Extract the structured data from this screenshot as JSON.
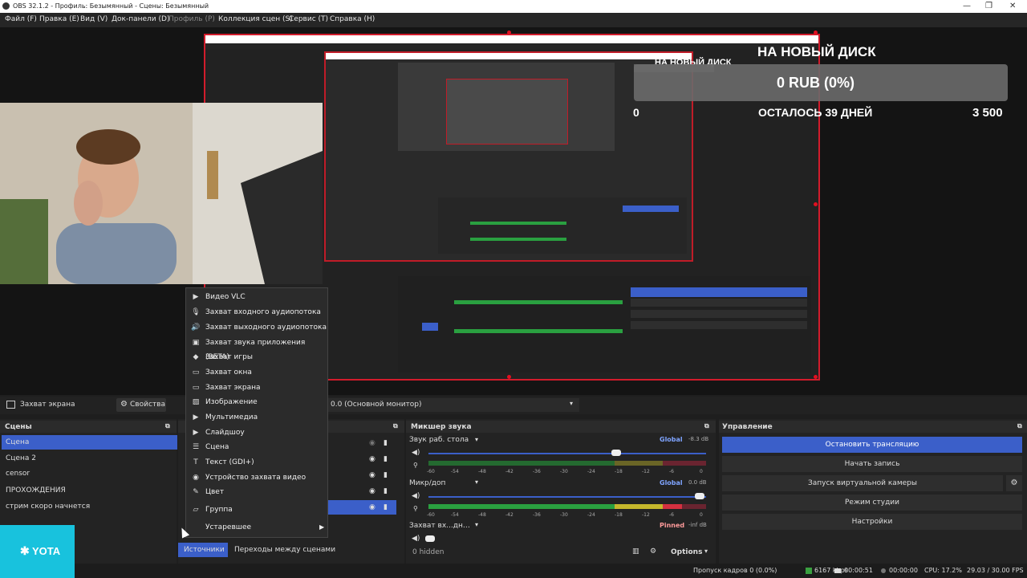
{
  "window": {
    "title": "OBS 32.1.2 - Профиль: Безымянный - Сцены: Безымянный",
    "minimize": "—",
    "maximize": "❐",
    "close": "✕"
  },
  "menu": [
    {
      "label": "Файл (F)"
    },
    {
      "label": "Правка (E)"
    },
    {
      "label": "Вид (V)"
    },
    {
      "label": "Док-панели (D)"
    },
    {
      "label": "Профиль (P)"
    },
    {
      "label": "Коллекция сцен (S)"
    },
    {
      "label": "Сервис (T)"
    },
    {
      "label": "Справка (H)"
    }
  ],
  "overlay": {
    "headline": "НА НОВЫЙ ДИСК",
    "progress_text": "0 RUB (0%)",
    "remaining": "ОСТАЛОСЬ 39 ДНЕЙ",
    "start_value": "0",
    "goal_value": "3 500",
    "nested_headline": "НА НОВЫЙ ДИСК"
  },
  "source_toolbar": {
    "source_name": "Захват экрана",
    "properties": "Свойства",
    "monitor": "0.0 (Основной монитор)"
  },
  "scenes": {
    "header": "Сцены",
    "items": [
      {
        "label": "Сцена",
        "selected": true
      },
      {
        "label": "Сцена 2"
      },
      {
        "label": "censor"
      },
      {
        "label": "ПРОХОЖДЕНИЯ"
      },
      {
        "label": "стрим скоро начнется"
      }
    ]
  },
  "context_menu": {
    "items": [
      {
        "label": "Видео VLC",
        "icon": "play-icon"
      },
      {
        "label": "Захват входного аудиопотока",
        "icon": "mic-icon"
      },
      {
        "label": "Захват выходного аудиопотока",
        "icon": "speaker-icon"
      },
      {
        "label": "Захват звука приложения (BETA)",
        "icon": "app-audio-icon"
      },
      {
        "label": "Захват игры",
        "icon": "gamepad-icon"
      },
      {
        "label": "Захват окна",
        "icon": "window-icon"
      },
      {
        "label": "Захват экрана",
        "icon": "monitor-icon"
      },
      {
        "label": "Изображение",
        "icon": "image-icon"
      },
      {
        "label": "Мультимедиа",
        "icon": "play-icon"
      },
      {
        "label": "Слайдшоу",
        "icon": "slideshow-icon"
      },
      {
        "label": "Сцена",
        "icon": "list-icon"
      },
      {
        "label": "Текст (GDI+)",
        "icon": "text-icon"
      },
      {
        "label": "Устройство захвата видео",
        "icon": "camera-icon"
      },
      {
        "label": "Цвет",
        "icon": "brush-icon"
      },
      {
        "label": "Группа",
        "icon": "folder-icon"
      },
      {
        "label": "Устаревшее",
        "icon": "",
        "submenu": true
      }
    ]
  },
  "sources_tabs": {
    "sources": "Источники",
    "transitions": "Переходы между сценами"
  },
  "mixer": {
    "header": "Микшер звука",
    "tracks": [
      {
        "name": "Звук раб. стола",
        "badge": "Global",
        "db": "-8.3 dB",
        "volume": 0.72
      },
      {
        "name": "Микр/доп",
        "badge": "Global",
        "db": "0.0 dB",
        "volume": 1.0
      },
      {
        "name": "Захват вх...дного аудиопотока",
        "badge": "Pinned",
        "db": "-inf dB",
        "volume": 0.02
      }
    ],
    "scale": [
      "-60",
      "-54",
      "-48",
      "-42",
      "-36",
      "-30",
      "-24",
      "-18",
      "-12",
      "-6",
      "0"
    ],
    "hidden": "0 hidden",
    "options": "Options"
  },
  "controls": {
    "header": "Управление",
    "buttons": [
      {
        "label": "Остановить трансляцию",
        "active": true
      },
      {
        "label": "Начать запись"
      },
      {
        "label": "Запуск виртуальной камеры"
      },
      {
        "label": "Режим студии"
      },
      {
        "label": "Настройки"
      }
    ]
  },
  "status": {
    "dropped": "Пропуск кадров 0 (0.0%)",
    "bitrate": "6167 kbps",
    "stream_time": "00:00:51",
    "rec_time": "00:00:00",
    "cpu": "CPU: 17.2%",
    "fps": "29.03 / 30.00 FPS"
  },
  "watermark": {
    "brand": "YOTA"
  },
  "colors": {
    "accent": "#3b5fc9",
    "border_red": "#d21c2c",
    "yota": "#18c2dd"
  }
}
